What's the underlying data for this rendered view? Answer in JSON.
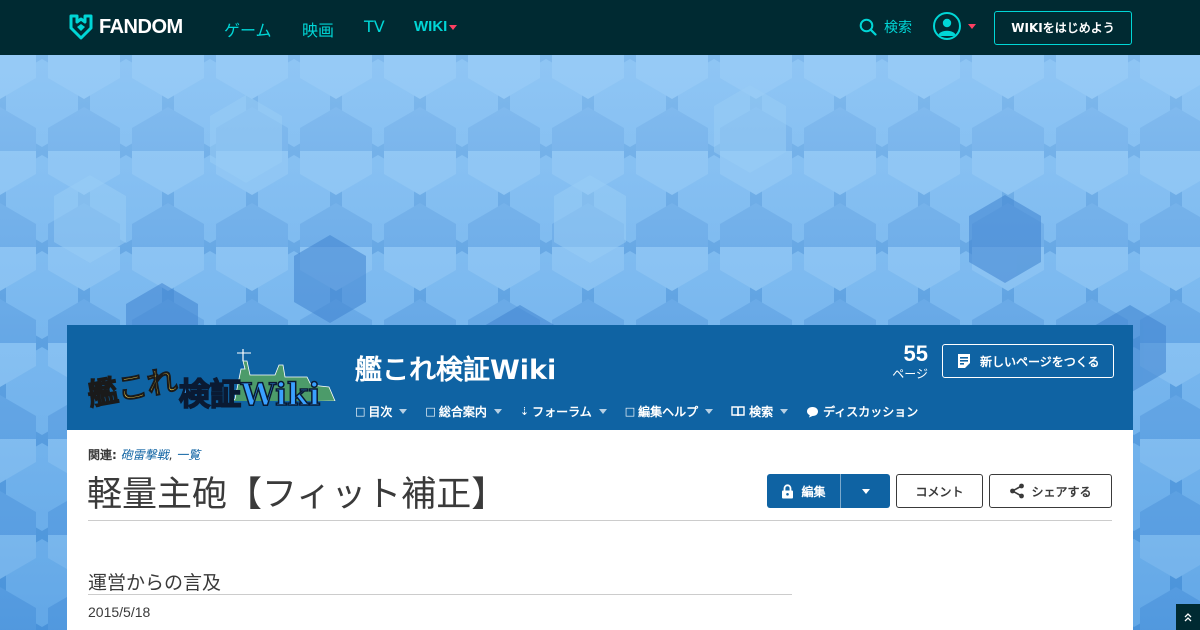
{
  "topbar": {
    "logo_text": "FANDOM",
    "nav": [
      "ゲーム",
      "映画",
      "TV"
    ],
    "wiki_label": "WIKI",
    "search_label": "検索",
    "start_wiki_label": "WIKIをはじめよう"
  },
  "wiki": {
    "logo_line1": "艦これ",
    "logo_line2": "検証Wiki",
    "title": "艦これ検証Wiki",
    "page_count": "55",
    "page_count_unit": "ページ",
    "new_page_label": "新しいページをつくる",
    "nav": [
      {
        "label": "目次",
        "dropdown": true
      },
      {
        "label": "総合案内",
        "dropdown": true
      },
      {
        "label": "フォーラム",
        "dropdown": true
      },
      {
        "label": "編集ヘルプ",
        "dropdown": true
      },
      {
        "label": "検索",
        "dropdown": true
      },
      {
        "label": "ディスカッション",
        "dropdown": false
      }
    ]
  },
  "article": {
    "related_label": "関連:",
    "related_links": [
      "砲雷撃戦",
      "一覧"
    ],
    "related_sep": ", ",
    "title": "軽量主砲【フィット補正】",
    "edit_label": "編集",
    "comment_label": "コメント",
    "share_label": "シェアする",
    "section_heading": "運営からの言及",
    "date": "2015/5/18"
  },
  "colors": {
    "topbar_bg": "#002a32",
    "accent_teal": "#00d6d6",
    "accent_red": "#fd3f62",
    "wiki_blue": "#0f63a3"
  }
}
